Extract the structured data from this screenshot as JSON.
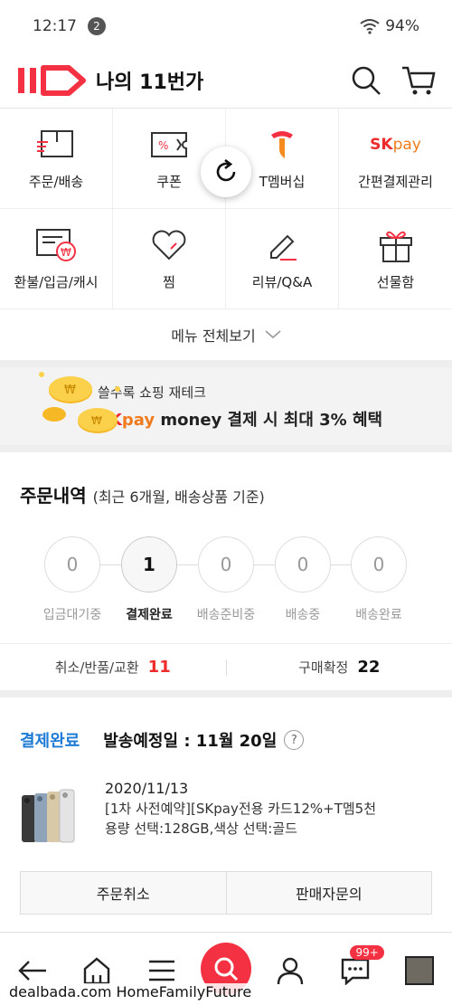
{
  "status_bar": {
    "time": "12:17",
    "notif_count": "2",
    "battery": "94%"
  },
  "header": {
    "logo_text": "11",
    "title": "나의 11번가"
  },
  "menu": {
    "items": [
      {
        "label": "주문/배송",
        "icon": "order-box-icon"
      },
      {
        "label": "쿠폰",
        "icon": "coupon-icon"
      },
      {
        "label": "T멤버십",
        "icon": "t-membership-icon"
      },
      {
        "label": "간편결제관리",
        "icon": "skpay-icon"
      },
      {
        "label": "환불/입금/캐시",
        "icon": "refund-icon"
      },
      {
        "label": "찜",
        "icon": "heart-icon"
      },
      {
        "label": "리뷰/Q&A",
        "icon": "pencil-icon"
      },
      {
        "label": "선물함",
        "icon": "gift-icon"
      }
    ],
    "skpay_logo": "SK pay",
    "view_all": "메뉴 전체보기"
  },
  "banner": {
    "sub": "쓸수록 쇼핑 재테크",
    "main_sk": "SK",
    "main_pay": "pay",
    "main_rest": " money 결제 시 최대 3% 혜택"
  },
  "orders": {
    "title": "주문내역",
    "subtitle": "(최근 6개월, 배송상품 기준)",
    "steps": [
      {
        "count": "0",
        "label": "입금대기중"
      },
      {
        "count": "1",
        "label": "결제완료"
      },
      {
        "count": "0",
        "label": "배송준비중"
      },
      {
        "count": "0",
        "label": "배송중"
      },
      {
        "count": "0",
        "label": "배송완료"
      }
    ],
    "summary": [
      {
        "label": "취소/반품/교환",
        "count": "11"
      },
      {
        "label": "구매확정",
        "count": "22"
      }
    ]
  },
  "order_card": {
    "status": "결제완료",
    "ship_date": "발송예정일 : 11월 20일",
    "help": "?",
    "product": {
      "date": "2020/11/13",
      "name": "[1차 사전예약][SKpay전용 카드12%+T멤5천",
      "options": "용량 선택:128GB,색상 선택:골드"
    },
    "buttons": {
      "cancel": "주문취소",
      "inquiry": "판매자문의"
    }
  },
  "bottom_nav": {
    "badge": "99+"
  },
  "watermark": "dealbada.com HomeFamilyFuture",
  "colors": {
    "brand_red": "#f43142",
    "status_blue": "#1d7bd5",
    "count_red": "#ee2b2b"
  }
}
